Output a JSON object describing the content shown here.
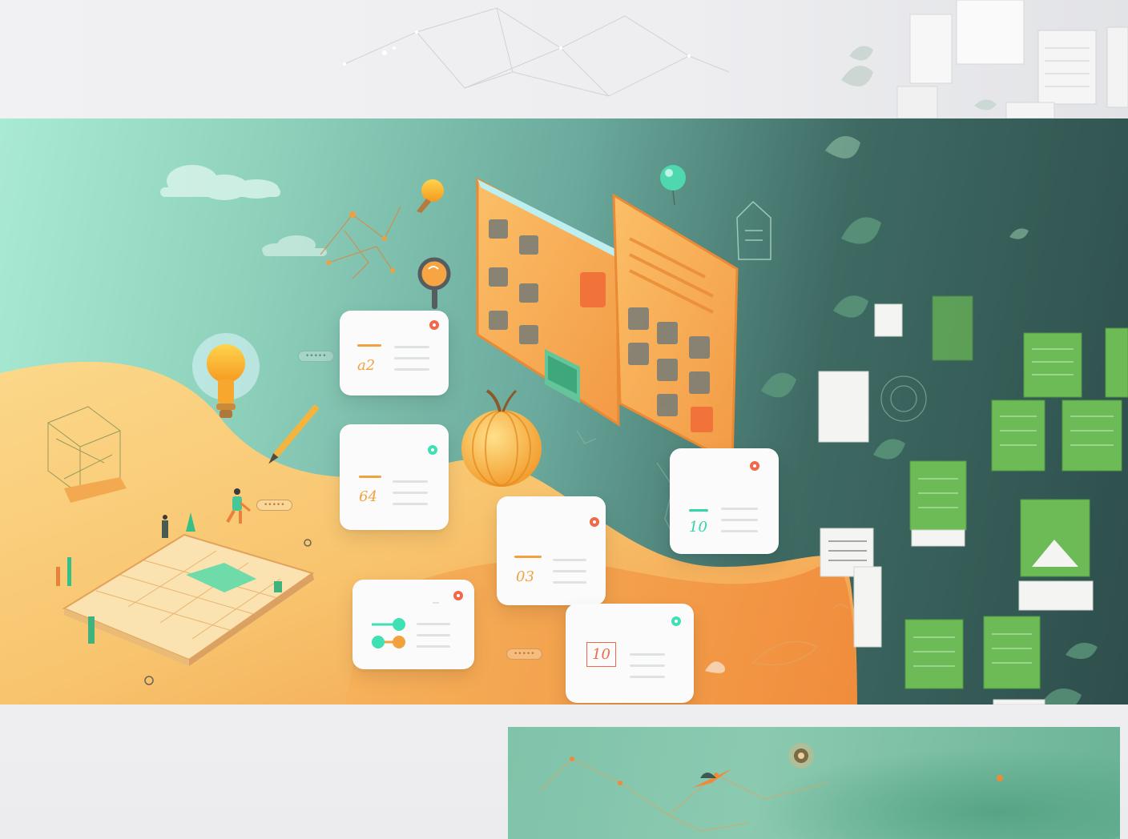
{
  "cards": [
    {
      "number": "a2",
      "dot_color": "#f0694a",
      "accent_color": "#f1a23f"
    },
    {
      "number": "64",
      "dot_color": "#3ee0b4",
      "accent_color": "#f1a23f"
    },
    {
      "number": "03",
      "dot_color": "#f0694a",
      "accent_color": "#f1a23f"
    },
    {
      "number": "10",
      "dot_color": "#f0694a",
      "accent_color": "#32d6a8"
    },
    {
      "number": "10",
      "dot_color": "#f0694a",
      "accent_color": "#f0694a"
    }
  ],
  "colors": {
    "mint": "#a9ead4",
    "teal": "#6aa99c",
    "dark_teal": "#2e4e4b",
    "sand": "#f7c66e",
    "orange": "#f28b3c",
    "leaf_green": "#6dbb57"
  },
  "icons": [
    "lightbulb-icon",
    "pencil-icon",
    "pumpkin-icon",
    "open-book-icon",
    "magnifier-icon",
    "leaf-icon",
    "file-drawer-icon",
    "cloud-icon",
    "balloon-icon",
    "person-figure-icon"
  ]
}
